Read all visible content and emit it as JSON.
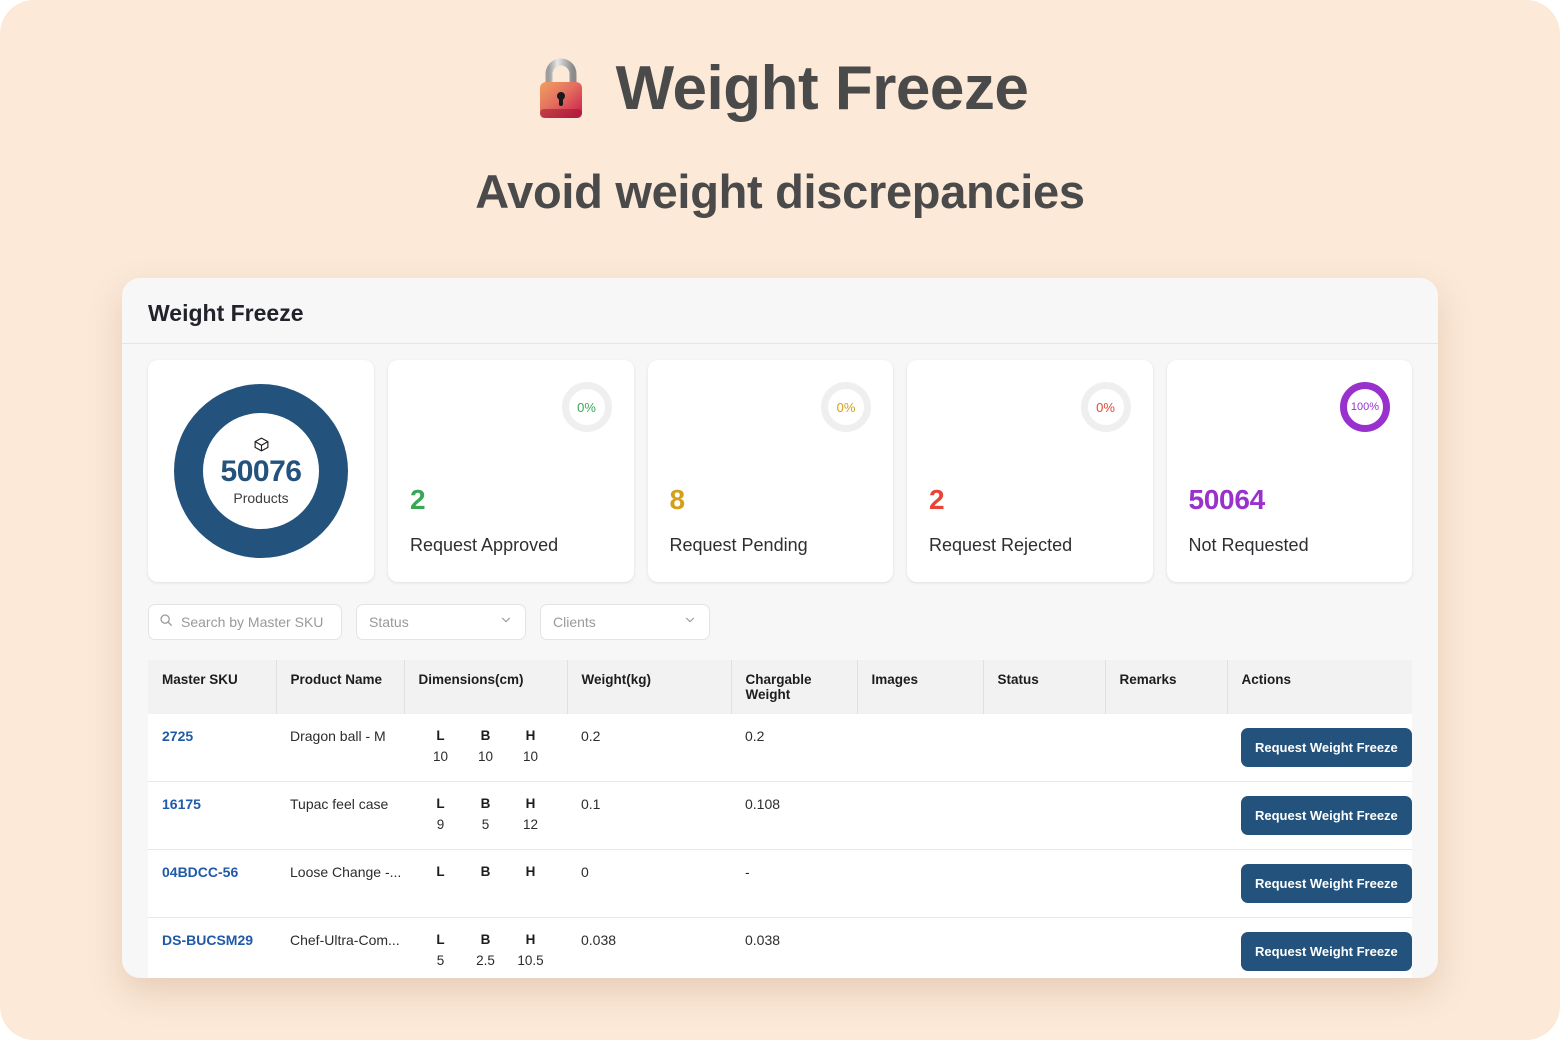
{
  "hero": {
    "icon": "lock-icon",
    "title": "Weight Freeze",
    "subtitle": "Avoid weight discrepancies"
  },
  "panel": {
    "title": "Weight Freeze"
  },
  "stats": {
    "donut": {
      "icon": "package-icon",
      "value": "50076",
      "label": "Products",
      "color": "#23527c"
    },
    "cards": [
      {
        "percent": "0%",
        "value": "2",
        "label": "Request Approved",
        "color": "#3aa757",
        "ring": "#efefef"
      },
      {
        "percent": "0%",
        "value": "8",
        "label": "Request Pending",
        "color": "#d4a017",
        "ring": "#efefef"
      },
      {
        "percent": "0%",
        "value": "2",
        "label": "Request Rejected",
        "color": "#ea4335",
        "ring": "#efefef"
      },
      {
        "percent": "100%",
        "value": "50064",
        "label": "Not Requested",
        "color": "#9932cc",
        "ring": "#9932cc"
      }
    ]
  },
  "filters": {
    "search_placeholder": "Search by Master SKU",
    "search_value": "",
    "search_icon": "search-icon",
    "status_label": "Status",
    "clients_label": "Clients",
    "chevron_icon": "chevron-down-icon"
  },
  "table": {
    "columns": [
      "Master SKU",
      "Product Name",
      "Dimensions(cm)",
      "Weight(kg)",
      "Chargable Weight",
      "Images",
      "Status",
      "Remarks",
      "Actions"
    ],
    "dim_keys": [
      "L",
      "B",
      "H"
    ],
    "action_label": "Request Weight Freeze",
    "rows": [
      {
        "sku": "2725",
        "name": "Dragon ball - M",
        "L": "10",
        "B": "10",
        "H": "10",
        "weight": "0.2",
        "chargable": "0.2",
        "images": "",
        "status": "",
        "remarks": ""
      },
      {
        "sku": "16175",
        "name": "Tupac feel case",
        "L": "9",
        "B": "5",
        "H": "12",
        "weight": "0.1",
        "chargable": "0.108",
        "images": "",
        "status": "",
        "remarks": ""
      },
      {
        "sku": "04BDCC-56",
        "name": "Loose Change -...",
        "L": "",
        "B": "",
        "H": "",
        "weight": "0",
        "chargable": "-",
        "images": "",
        "status": "",
        "remarks": ""
      },
      {
        "sku": "DS-BUCSM29",
        "name": "Chef-Ultra-Com...",
        "L": "5",
        "B": "2.5",
        "H": "10.5",
        "weight": "0.038",
        "chargable": "0.038",
        "images": "",
        "status": "",
        "remarks": ""
      }
    ]
  }
}
